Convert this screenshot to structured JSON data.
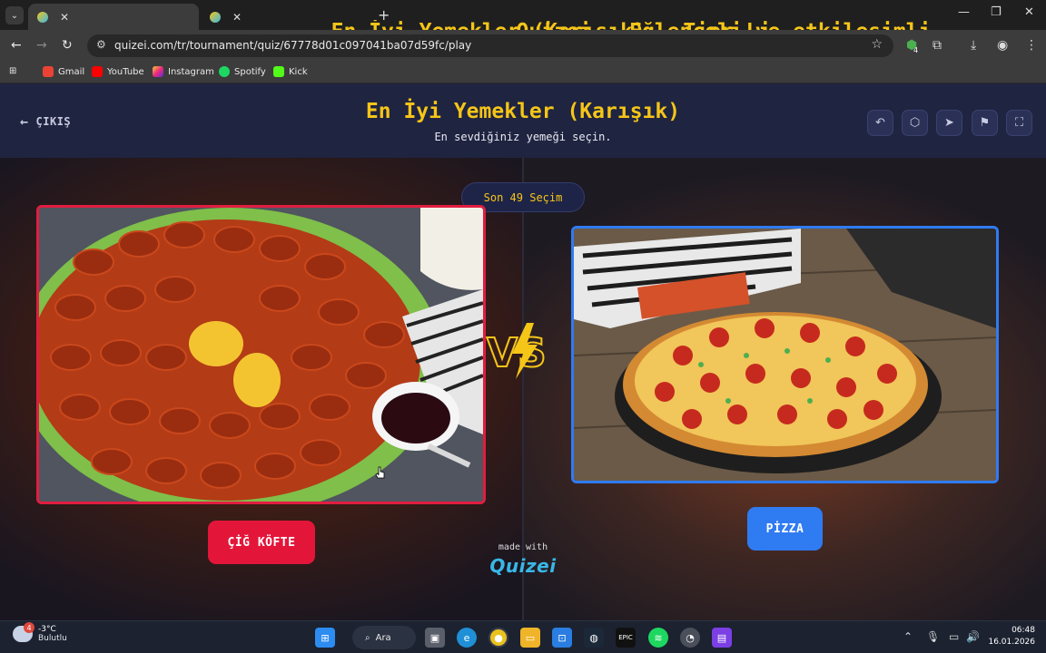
{
  "browser": {
    "tabs": [
      {
        "title": "En İyi Yemekler (Karışık) - Tier Li",
        "active": true
      },
      {
        "title": "Quizei - Eğlenceli ve etkileşimli",
        "active": false
      }
    ],
    "url": "quizei.com/tr/tournament/quiz/67778d01c097041ba07d59fc/play",
    "bookmarks": [
      "Gmail",
      "YouTube",
      "Instagram",
      "Spotify",
      "Kick"
    ],
    "extension_badge": "4"
  },
  "header": {
    "exit_label": "ÇIKIŞ",
    "title": "En İyi Yemekler (Karışık)",
    "subtitle": "En sevdiğiniz yemeği seçin."
  },
  "arena": {
    "remaining_label": "Son 49 Seçim",
    "left_choice": "ÇİĞ KÖFTE",
    "right_choice": "PİZZA",
    "vs_text": "VS",
    "made_with": "made with",
    "logo_text": "Quizei"
  },
  "colors": {
    "accent": "#f5c518",
    "left": "#e3163a",
    "right": "#2f7bf2",
    "header_bg": "#1f2440"
  },
  "taskbar": {
    "temperature": "-3°C",
    "condition": "Bulutlu",
    "weather_badge": "4",
    "search_label": "Ara",
    "time": "06:48",
    "date": "16.01.2026"
  }
}
